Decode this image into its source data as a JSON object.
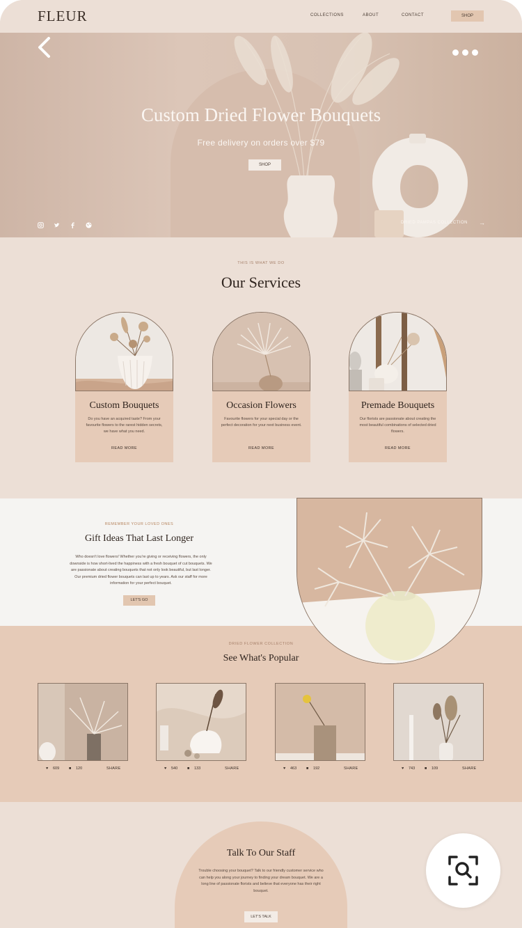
{
  "nav": {
    "logo": "FLEUR",
    "links": [
      "COLLECTIONS",
      "ABOUT",
      "CONTACT"
    ],
    "shop_label": "SHOP"
  },
  "hero": {
    "title": "Custom Dried Flower Bouquets",
    "subtitle": "Free delivery on orders over $79",
    "shop_label": "SHOP",
    "collection_link": "DRIED PAMPAS COLLECTION",
    "social_icons": [
      "instagram-icon",
      "twitter-icon",
      "facebook-icon",
      "globe-icon"
    ]
  },
  "services": {
    "eyebrow": "THIS IS WHAT WE DO",
    "title": "Our Services",
    "cards": [
      {
        "title": "Custom Bouquets",
        "text": "Do you have an acquired taste? From your favourite flowers to the rarest hidden secrets, we have what you need.",
        "link": "READ MORE"
      },
      {
        "title": "Occasion Flowers",
        "text": "Favourite flowers for your special day or the perfect decoration for your next business event.",
        "link": "READ MORE"
      },
      {
        "title": "Premade Bouquets",
        "text": "Our florists are passionate about creating the most beautiful combinations of selected dried flowers.",
        "link": "READ MORE"
      }
    ]
  },
  "gift": {
    "eyebrow": "REMEMBER YOUR LOVED ONES",
    "title": "Gift Ideas That Last Longer",
    "text": "Who doesn't love flowers! Whether you're giving or receiving flowers, the only downside is how short-lived the happiness with a fresh bouquet of cut bouquets. We are passionate about creating bouquets that not only look beautiful, but last longer. Our premium dried flower bouquets can last up to years. Ask our staff for more information for your perfect bouquet.",
    "button": "LET'S GO"
  },
  "popular": {
    "eyebrow": "DRIED FLOWER COLLECTION",
    "title": "See What's Popular",
    "items": [
      {
        "likes": "609",
        "comments": "120",
        "share": "SHARE"
      },
      {
        "likes": "540",
        "comments": "133",
        "share": "SHARE"
      },
      {
        "likes": "463",
        "comments": "192",
        "share": "SHARE"
      },
      {
        "likes": "743",
        "comments": "109",
        "share": "SHARE"
      }
    ]
  },
  "staff": {
    "title": "Talk To Our Staff",
    "text": "Trouble choosing your bouquet? Talk to our friendly customer service who can help you along your journey to finding your dream bouquet. We are a long line of passionate florists and believe that everyone has their right bouquet.",
    "button": "LET'S TALK"
  },
  "overlay": {
    "back_icon": "chevron-left-icon",
    "more_icon": "more-dots-icon",
    "lens_icon": "visual-search-icon"
  },
  "colors": {
    "page_bg": "#ecdfd6",
    "accent": "#e6cbb8",
    "button": "#e2c6b0",
    "ink": "#2f241e"
  }
}
